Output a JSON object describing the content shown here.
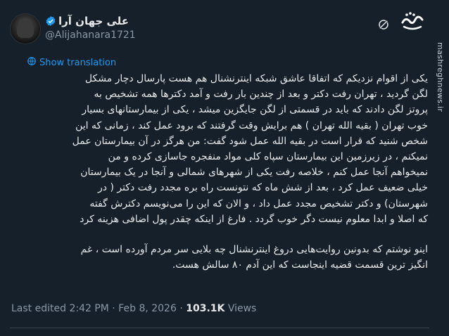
{
  "author": {
    "display_name": "علی جهان آرا",
    "handle": "@Alijahanara1721"
  },
  "icons": {
    "verified": "verified-badge-icon",
    "grok": "grok-icon",
    "translate": "globe-icon"
  },
  "colors": {
    "background": "#15202b",
    "accent": "#1d9bf0",
    "text": "#e7e9ea",
    "muted": "#8b98a5"
  },
  "watermark": {
    "brand": "مشرق",
    "site": "mashreghnews.ir"
  },
  "tweet": {
    "show_translation": "Show translation",
    "lines_p1": [
      "یکی از اقوام نزدیکم که اتفاقا عاشق شبکه اینترنشنال هم هست پارسال دچار مشکل",
      "لگن گردید ، تهران رفت دکتر و بعد از چندین بار رفت و آمد دکترها همه تشخیص به",
      "پروتز لگن دادند که باید در قسمتی از لگن جایگزین میشد ، یکی از بیمارستانهای بسیار",
      "خوب تهران ( بقیه الله تهران ) هم برایش وقت گرفتند که برود عمل کند ، زمانی که این",
      "شخص شنید که قرار است در بقیه الله عمل شود گفت: من هرگز در آن بیمارستان عمل",
      "نمیکنم ، در زیرزمین این بیمارستان سپاه کلی مواد منفجره جاسازی کرده و من",
      "نمیخواهم آنجا عمل کنم ، خلاصه رفت یکی از شهرهای شمالی و آنجا در یک بیمارستان",
      "خیلی ضعیف عمل کرد ، بعد از شش ماه که نتونست راه بره مجدد رفت دکتر ( در",
      "شهرستان) و دکتر تشخیص مجدد عمل داد ، و الان که این را می‌نویسم دکترش گفته",
      "که اصلا و ابدا معلوم نیست دگر خوب گردد . فارغ از اینکه چقدر پول اضافی هزینه کرد"
    ],
    "lines_p2": [
      "اینو نوشتم که بدونین روایت‌هایی دروغ اینترنشنال چه بلایی سر مردم آورده است ، غم",
      "انگیز ترین قسمت قضیه اینجاست که این آدم ۸۰ سالش هست."
    ],
    "edited_label": "Last edited 2:42 PM · Feb 8, 2026 · ",
    "views_count": "103.1K",
    "views_label": " Views"
  }
}
